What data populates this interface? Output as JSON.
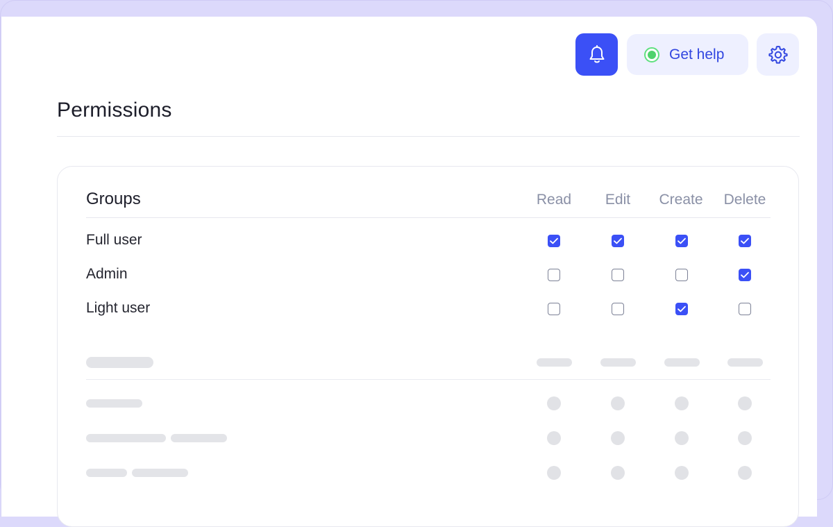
{
  "header": {
    "notifications_icon": "bell-icon",
    "help": {
      "label": "Get help",
      "status_color": "#4fd26c"
    },
    "settings_icon": "gear-icon"
  },
  "page": {
    "title": "Permissions"
  },
  "permissions_table": {
    "group_header": "Groups",
    "columns": [
      "Read",
      "Edit",
      "Create",
      "Delete"
    ],
    "rows": [
      {
        "label": "Full user",
        "checks": [
          true,
          true,
          true,
          true
        ]
      },
      {
        "label": "Admin",
        "checks": [
          false,
          false,
          false,
          true
        ]
      },
      {
        "label": "Light user",
        "checks": [
          false,
          false,
          true,
          false
        ]
      }
    ]
  },
  "colors": {
    "accent": "#3b50f6",
    "frame": "#dcd9fb"
  }
}
